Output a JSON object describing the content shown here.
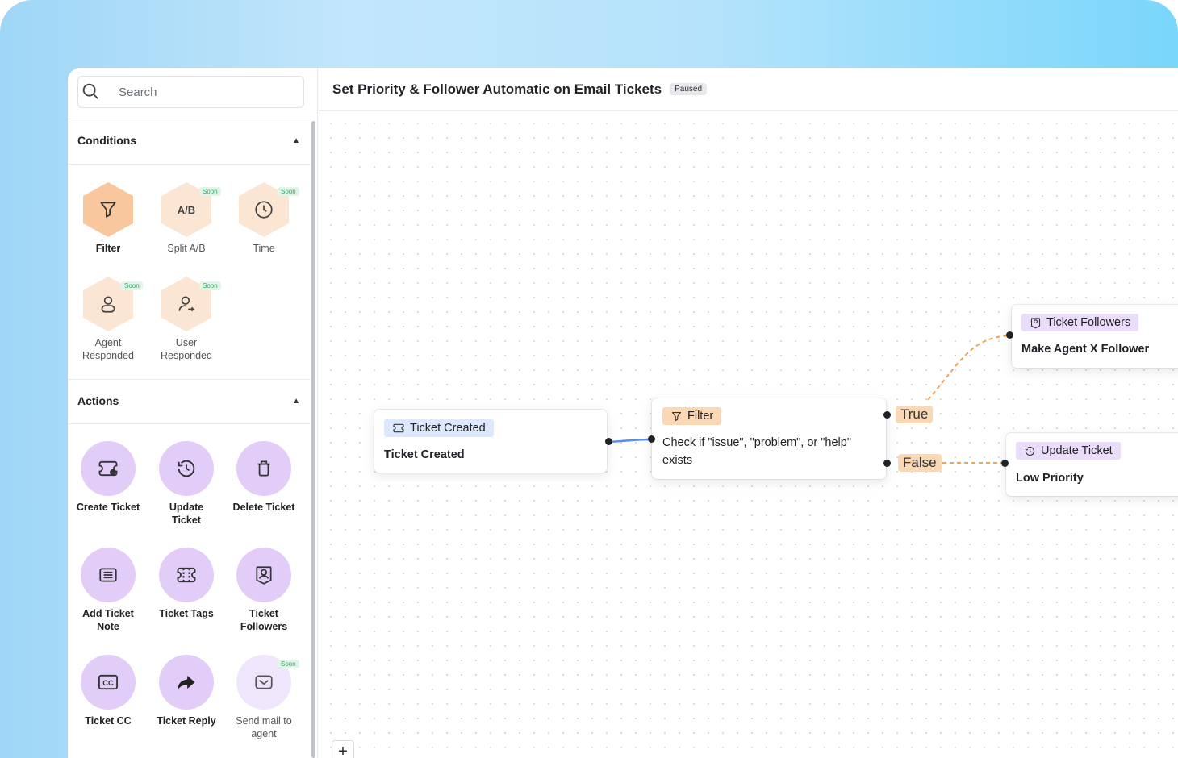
{
  "search": {
    "placeholder": "Search"
  },
  "conditions": {
    "label": "Conditions",
    "items": [
      {
        "label": "Filter",
        "icon": "funnel-icon",
        "soon": false
      },
      {
        "label": "Split A/B",
        "icon": "split-ab-icon",
        "soon": true
      },
      {
        "label": "Time",
        "icon": "clock-icon",
        "soon": true
      },
      {
        "label": "Agent Responded",
        "icon": "agent-icon",
        "soon": true
      },
      {
        "label": "User Responded",
        "icon": "user-icon",
        "soon": true
      }
    ]
  },
  "actions": {
    "label": "Actions",
    "items": [
      {
        "label": "Create Ticket",
        "icon": "create-ticket-icon",
        "soon": false
      },
      {
        "label": "Update Ticket",
        "icon": "history-icon",
        "soon": false
      },
      {
        "label": "Delete Ticket",
        "icon": "trash-icon",
        "soon": false
      },
      {
        "label": "Add Ticket Note",
        "icon": "note-icon",
        "soon": false
      },
      {
        "label": "Ticket Tags",
        "icon": "ticket-icon",
        "soon": false
      },
      {
        "label": "Ticket Followers",
        "icon": "followers-icon",
        "soon": false
      },
      {
        "label": "Ticket CC",
        "icon": "cc-icon",
        "soon": false
      },
      {
        "label": "Ticket Reply",
        "icon": "reply-icon",
        "soon": false
      },
      {
        "label": "Send mail to agent",
        "icon": "mail-icon",
        "soon": true
      }
    ]
  },
  "soon_label": "Soon",
  "workflow": {
    "title": "Set Priority & Follower Automatic on Email Tickets",
    "status": "Paused"
  },
  "nodes": {
    "trigger": {
      "chip": "Ticket Created",
      "text": "Ticket Created"
    },
    "filter": {
      "chip": "Filter",
      "text": "Check if \"issue\", \"problem\", or \"help\" exists"
    },
    "followers": {
      "chip": "Ticket Followers",
      "text": "Make Agent X Follower"
    },
    "update": {
      "chip": "Update Ticket",
      "text": "Low Priority"
    }
  },
  "branches": {
    "true_label": "True",
    "false_label": "False"
  },
  "colors": {
    "condition_active": "#f8c79d",
    "action_active": "#e1cdf7",
    "connector_blue": "#5b8def",
    "connector_orange": "#f0a35a"
  },
  "add_button_label": "+"
}
